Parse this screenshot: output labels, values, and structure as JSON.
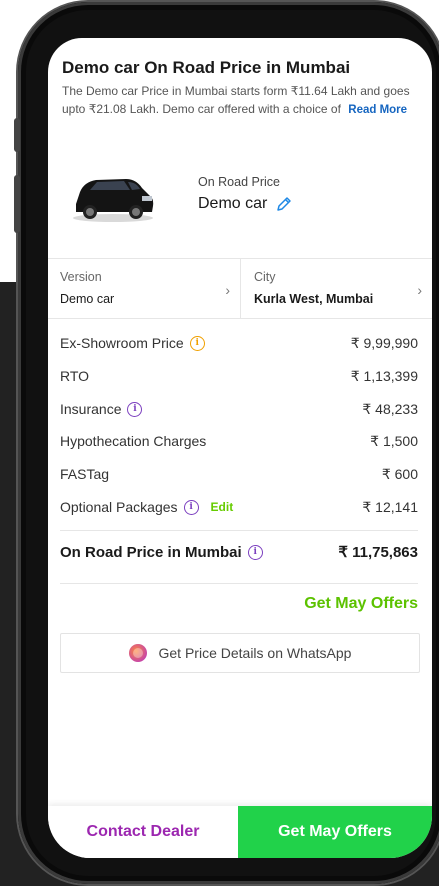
{
  "header": {
    "title": "Demo car On Road Price in Mumbai",
    "description": "The Demo car Price in Mumbai starts form ₹11.64 Lakh and goes upto ₹21.08 Lakh. Demo car offered with a choice of",
    "read_more": "Read More"
  },
  "car": {
    "on_road_label": "On Road Price",
    "name": "Demo car",
    "icon": "pencil-icon"
  },
  "selectors": {
    "version_label": "Version",
    "version_value": "Demo car",
    "city_label": "City",
    "city_value": "Kurla West, Mumbai",
    "chevron": "›"
  },
  "price_rows": [
    {
      "label": "Ex-Showroom Price",
      "value": "₹ 9,99,990"
    },
    {
      "label": "RTO",
      "value": "₹ 1,13,399"
    },
    {
      "label": "Insurance",
      "value": "₹ 48,233"
    },
    {
      "label": "Hypothecation Charges",
      "value": "₹ 1,500"
    },
    {
      "label": "FASTag",
      "value": "₹ 600"
    },
    {
      "label": "Optional Packages",
      "value": "₹ 12,141",
      "edit": "Edit"
    }
  ],
  "total": {
    "label": "On Road Price in Mumbai",
    "value": "₹ 11,75,863"
  },
  "offers_link": "Get May Offers",
  "whatsapp_button": "Get Price Details on WhatsApp",
  "bottom_bar": {
    "contact": "Contact Dealer",
    "offers": "Get May Offers"
  },
  "colors": {
    "accent_green": "#21d24a",
    "accent_purple": "#9c27b0",
    "link_blue": "#1565c0"
  }
}
